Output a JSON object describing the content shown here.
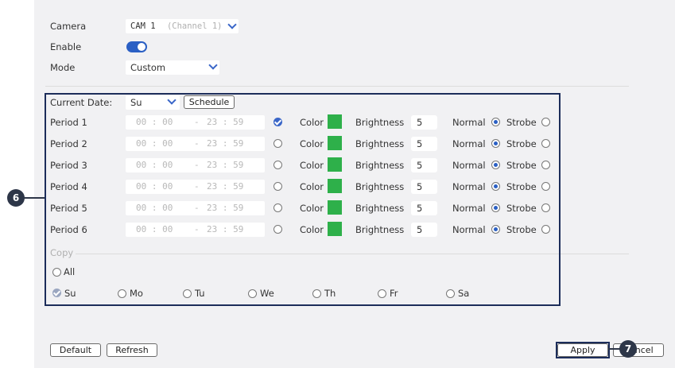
{
  "camera": {
    "label": "Camera",
    "value": "CAM 1",
    "channel": "(Channel 1)"
  },
  "enable": {
    "label": "Enable",
    "state": "on"
  },
  "mode": {
    "label": "Mode",
    "value": "Custom"
  },
  "current_date": {
    "label": "Current Date:",
    "value": "Su",
    "schedule_label": "Schedule"
  },
  "periods": [
    {
      "label": "Period 1",
      "start": "00 : 00",
      "end": "23 : 59",
      "checked": true,
      "color_label": "Color",
      "brightness_label": "Brightness",
      "brightness": "5",
      "normal_label": "Normal",
      "strobe_label": "Strobe"
    },
    {
      "label": "Period 2",
      "start": "00 : 00",
      "end": "23 : 59",
      "checked": false,
      "color_label": "Color",
      "brightness_label": "Brightness",
      "brightness": "5",
      "normal_label": "Normal",
      "strobe_label": "Strobe"
    },
    {
      "label": "Period 3",
      "start": "00 : 00",
      "end": "23 : 59",
      "checked": false,
      "color_label": "Color",
      "brightness_label": "Brightness",
      "brightness": "5",
      "normal_label": "Normal",
      "strobe_label": "Strobe"
    },
    {
      "label": "Period 4",
      "start": "00 : 00",
      "end": "23 : 59",
      "checked": false,
      "color_label": "Color",
      "brightness_label": "Brightness",
      "brightness": "5",
      "normal_label": "Normal",
      "strobe_label": "Strobe"
    },
    {
      "label": "Period 5",
      "start": "00 : 00",
      "end": "23 : 59",
      "checked": false,
      "color_label": "Color",
      "brightness_label": "Brightness",
      "brightness": "5",
      "normal_label": "Normal",
      "strobe_label": "Strobe"
    },
    {
      "label": "Period 6",
      "start": "00 : 00",
      "end": "23 : 59",
      "checked": false,
      "color_label": "Color",
      "brightness_label": "Brightness",
      "brightness": "5",
      "normal_label": "Normal",
      "strobe_label": "Strobe"
    }
  ],
  "time_dash": "-",
  "color_swatch": "#2eb04a",
  "copy": {
    "label": "Copy",
    "all_label": "All",
    "days": [
      "Su",
      "Mo",
      "Tu",
      "We",
      "Th",
      "Fr",
      "Sa"
    ]
  },
  "buttons": {
    "default": "Default",
    "refresh": "Refresh",
    "apply": "Apply",
    "cancel": "Cancel"
  },
  "callouts": {
    "c6": "6",
    "c7": "7"
  }
}
